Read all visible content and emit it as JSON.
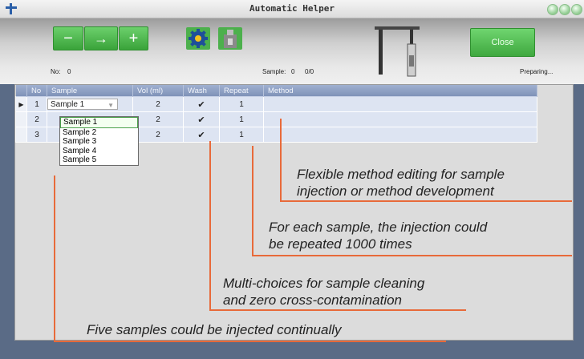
{
  "window": {
    "title": "Automatic Helper"
  },
  "toolbar": {
    "minus_label": "−",
    "arrow_label": "→",
    "plus_label": "+",
    "close_label": "Close",
    "icons": [
      "gear-icon",
      "bottle-icon",
      "syringe-stand-icon"
    ]
  },
  "status": {
    "no_label": "No:",
    "no_value": "0",
    "sample_label": "Sample:",
    "sample_value": "0",
    "sample_progress": "0/0",
    "state": "Preparing..."
  },
  "table": {
    "columns": [
      "No",
      "Sample",
      "Vol (ml)",
      "Wash",
      "Repeat",
      "Method"
    ],
    "rows": [
      {
        "no": "1",
        "sample": "Sample 1",
        "vol": "2",
        "wash": "✔",
        "repeat": "1",
        "method": ""
      },
      {
        "no": "2",
        "sample": "",
        "vol": "2",
        "wash": "✔",
        "repeat": "1",
        "method": ""
      },
      {
        "no": "3",
        "sample": "",
        "vol": "2",
        "wash": "✔",
        "repeat": "1",
        "method": ""
      }
    ],
    "dropdown_options": [
      "Sample 1",
      "Sample 2",
      "Sample 3",
      "Sample 4",
      "Sample 5"
    ],
    "dropdown_selected": "Sample 1"
  },
  "annotations": {
    "method": [
      "Flexible method editing for sample",
      "injection or method development"
    ],
    "repeat": [
      "For each sample, the injection could",
      "be repeated 1000 times"
    ],
    "wash": [
      "Multi-choices for sample cleaning",
      "and zero cross-contamination"
    ],
    "sample": "Five samples could be injected continually"
  },
  "colors": {
    "accent_green": "#3aa33a",
    "header_blue": "#8a9cc2",
    "callout_orange": "#e86a3a",
    "frame": "#5a6b86"
  }
}
